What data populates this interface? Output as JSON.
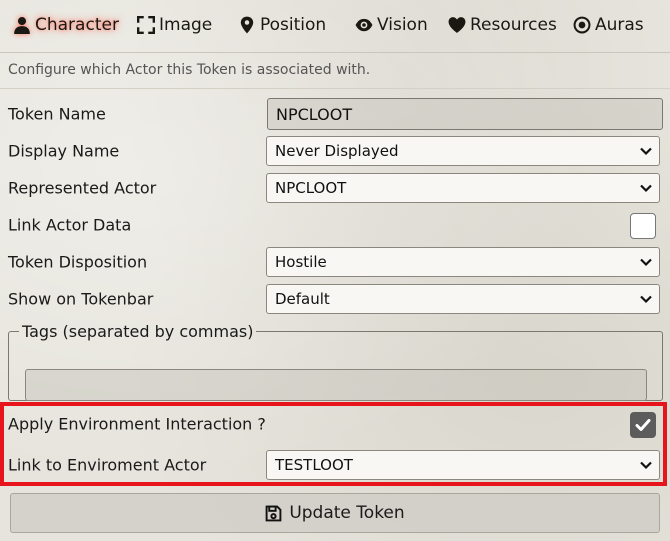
{
  "tabs": [
    {
      "label": "Character",
      "icon": "user-icon",
      "active": true
    },
    {
      "label": "Image",
      "icon": "expand-icon",
      "active": false
    },
    {
      "label": "Position",
      "icon": "map-marker-icon",
      "active": false
    },
    {
      "label": "Vision",
      "icon": "eye-icon",
      "active": false
    },
    {
      "label": "Resources",
      "icon": "heart-icon",
      "active": false
    },
    {
      "label": "Auras",
      "icon": "dot-circle-icon",
      "active": false
    }
  ],
  "hint": "Configure which Actor this Token is associated with.",
  "form": {
    "token_name": {
      "label": "Token Name",
      "value": "NPCLOOT"
    },
    "display_name": {
      "label": "Display Name",
      "value": "Never Displayed"
    },
    "represented_actor": {
      "label": "Represented Actor",
      "value": "NPCLOOT"
    },
    "link_actor_data": {
      "label": "Link Actor Data",
      "checked": false
    },
    "token_disposition": {
      "label": "Token Disposition",
      "value": "Hostile"
    },
    "show_on_tokenbar": {
      "label": "Show on Tokenbar",
      "value": "Default"
    },
    "tags": {
      "legend": "Tags (separated by commas)",
      "value": ""
    },
    "apply_env": {
      "label": "Apply Environment Interaction ?",
      "checked": true
    },
    "link_env_actor": {
      "label": "Link to Enviroment Actor",
      "value": "TESTLOOT"
    }
  },
  "update_button": {
    "label": "Update Token",
    "icon": "save-icon"
  },
  "colors": {
    "highlight": "#e8141c",
    "active_glow": "#ff6e5a"
  }
}
